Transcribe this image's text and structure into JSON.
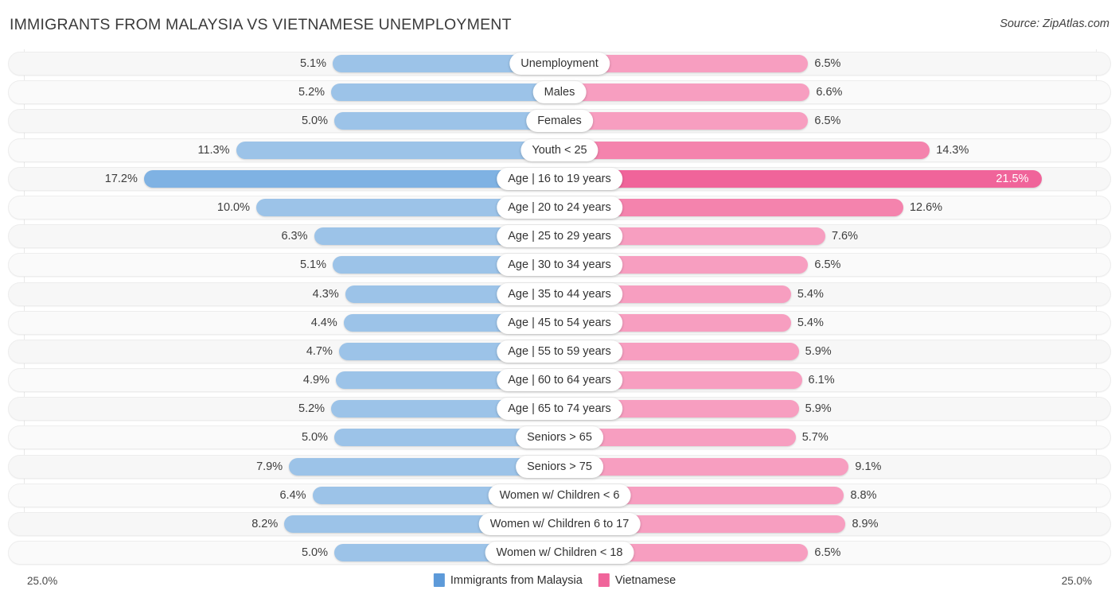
{
  "header": {
    "title": "IMMIGRANTS FROM MALAYSIA VS VIETNAMESE UNEMPLOYMENT",
    "source": "Source: ZipAtlas.com"
  },
  "legend": {
    "left_label": "Immigrants from Malaysia",
    "right_label": "Vietnamese",
    "left_color": "#5d9ad9",
    "right_color": "#f0649a"
  },
  "axis": {
    "left_max": "25.0%",
    "right_max": "25.0%"
  },
  "chart_data": {
    "type": "bar",
    "title": "IMMIGRANTS FROM MALAYSIA VS VIETNAMESE UNEMPLOYMENT",
    "subtitle": "",
    "xlabel": "",
    "ylabel": "",
    "orientation": "horizontal-diverging",
    "grid": true,
    "legend_position": "bottom-center",
    "axis_max": 25.0,
    "units": "%",
    "categories": [
      "Unemployment",
      "Males",
      "Females",
      "Youth < 25",
      "Age | 16 to 19 years",
      "Age | 20 to 24 years",
      "Age | 25 to 29 years",
      "Age | 30 to 34 years",
      "Age | 35 to 44 years",
      "Age | 45 to 54 years",
      "Age | 55 to 59 years",
      "Age | 60 to 64 years",
      "Age | 65 to 74 years",
      "Seniors > 65",
      "Seniors > 75",
      "Women w/ Children < 6",
      "Women w/ Children 6 to 17",
      "Women w/ Children < 18"
    ],
    "series": [
      {
        "name": "Immigrants from Malaysia",
        "color": "#5d9ad9",
        "values": [
          5.1,
          5.2,
          5.0,
          11.3,
          17.2,
          10.0,
          6.3,
          5.1,
          4.3,
          4.4,
          4.7,
          4.9,
          5.2,
          5.0,
          7.9,
          6.4,
          8.2,
          5.0
        ],
        "labels": [
          "5.1%",
          "5.2%",
          "5.0%",
          "11.3%",
          "17.2%",
          "10.0%",
          "6.3%",
          "5.1%",
          "4.3%",
          "4.4%",
          "4.7%",
          "4.9%",
          "5.2%",
          "5.0%",
          "7.9%",
          "6.4%",
          "8.2%",
          "5.0%"
        ]
      },
      {
        "name": "Vietnamese",
        "color": "#f0649a",
        "values": [
          6.5,
          6.6,
          6.5,
          14.3,
          21.5,
          12.6,
          7.6,
          6.5,
          5.4,
          5.4,
          5.9,
          6.1,
          5.9,
          5.7,
          9.1,
          8.8,
          8.9,
          6.5
        ],
        "labels": [
          "6.5%",
          "6.6%",
          "6.5%",
          "14.3%",
          "21.5%",
          "12.6%",
          "7.6%",
          "6.5%",
          "5.4%",
          "5.4%",
          "5.9%",
          "6.1%",
          "5.9%",
          "5.7%",
          "9.1%",
          "8.8%",
          "8.9%",
          "6.5%"
        ]
      }
    ]
  }
}
